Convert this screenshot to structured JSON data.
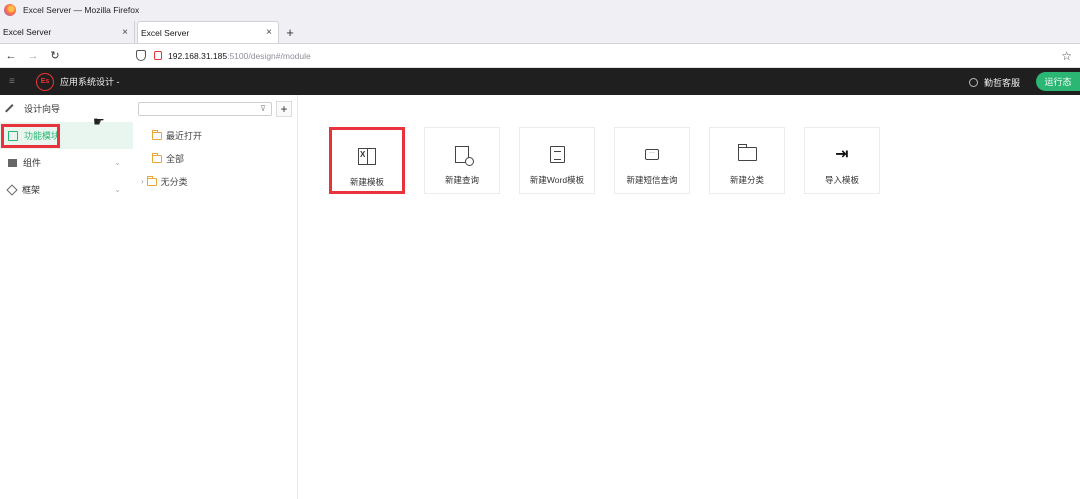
{
  "browser": {
    "window_title": "Excel Server — Mozilla Firefox",
    "tabs": [
      {
        "label": "Excel Server",
        "active": false
      },
      {
        "label": "Excel Server",
        "active": true
      }
    ],
    "url_host": "192.168.31.185",
    "url_rest": ":5100/design#/module"
  },
  "app": {
    "name": "应用系统设计 -",
    "logo_text": "Es",
    "support_label": "勤哲客服",
    "run_state_label": "运行态"
  },
  "sidebar": {
    "items": [
      {
        "label": "设计向导",
        "active": false
      },
      {
        "label": "功能模块",
        "active": true
      },
      {
        "label": "组件",
        "active": false
      },
      {
        "label": "框架",
        "active": false
      }
    ]
  },
  "tree": {
    "search_placeholder": "",
    "add_label": "+",
    "nodes": [
      {
        "label": "最近打开"
      },
      {
        "label": "全部"
      },
      {
        "label": "无分类"
      }
    ]
  },
  "main": {
    "cards": [
      {
        "label": "新建模板",
        "icon": "excel-template-icon",
        "highlighted": true
      },
      {
        "label": "新建查询",
        "icon": "query-icon",
        "highlighted": false
      },
      {
        "label": "新建Word模板",
        "icon": "word-doc-icon",
        "highlighted": false
      },
      {
        "label": "新建短信查询",
        "icon": "message-icon",
        "highlighted": false
      },
      {
        "label": "新建分类",
        "icon": "folder-icon",
        "highlighted": false
      },
      {
        "label": "导入模板",
        "icon": "import-icon",
        "highlighted": false
      }
    ]
  },
  "colors": {
    "accent": "#2bb673",
    "highlight": "#e8323c",
    "header_bg": "#1f1f1f"
  }
}
